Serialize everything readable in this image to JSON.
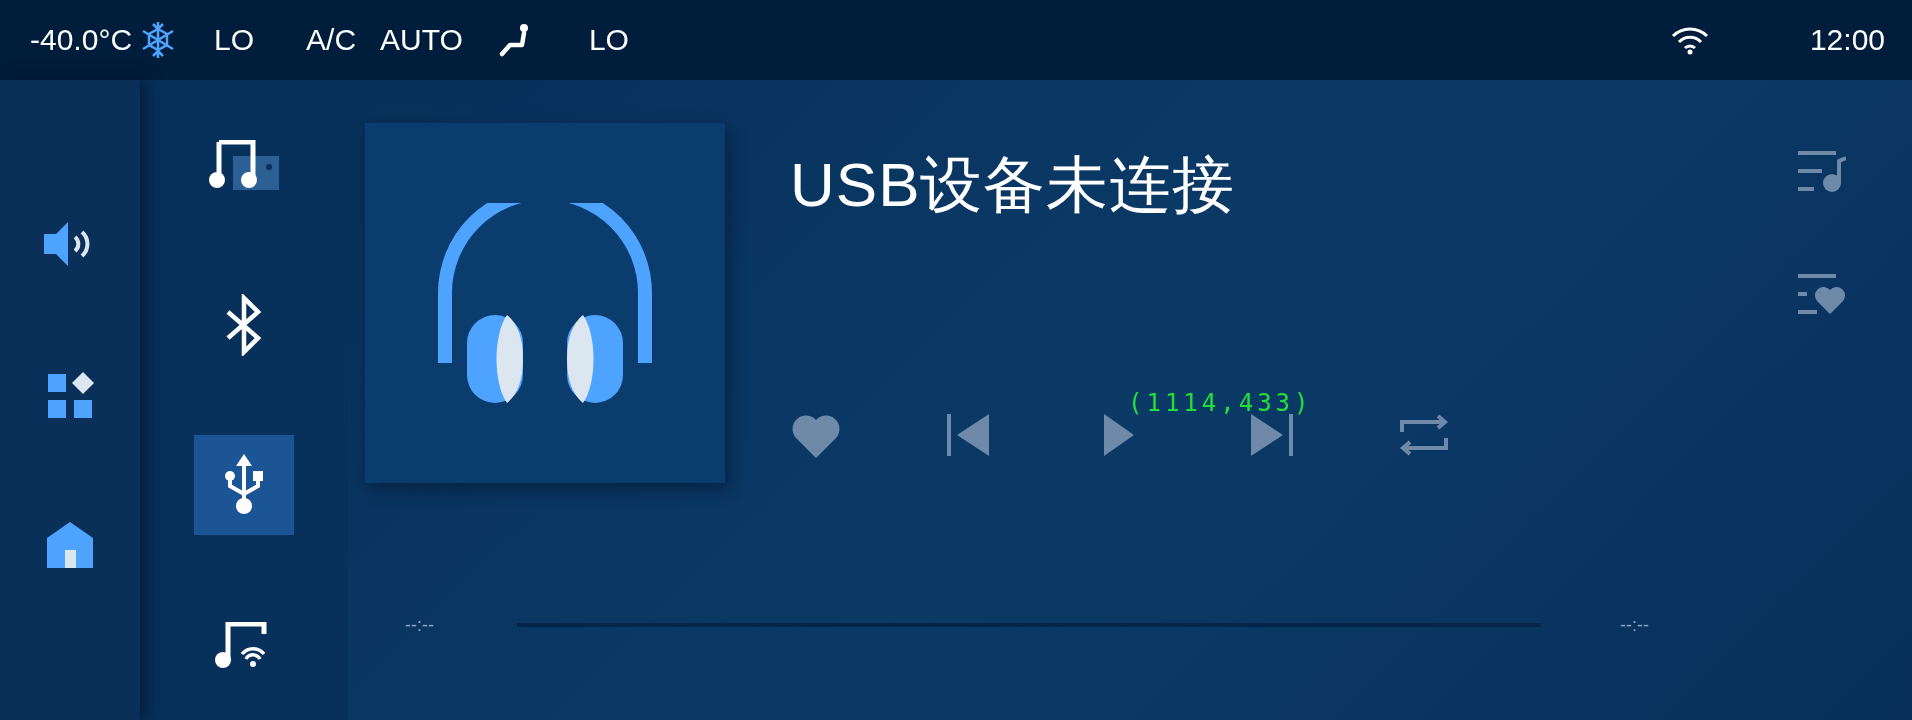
{
  "status_bar": {
    "temperature": "-40.0°C",
    "fan_level": "LO",
    "ac": "A/C",
    "mode": "AUTO",
    "seat_level": "LO",
    "time": "12:00"
  },
  "rail": [
    {
      "kind": "volume"
    },
    {
      "kind": "apps"
    },
    {
      "kind": "home"
    }
  ],
  "sources": [
    {
      "kind": "radio",
      "selected": false
    },
    {
      "kind": "bluetooth",
      "selected": false
    },
    {
      "kind": "usb",
      "selected": true
    },
    {
      "kind": "online-music",
      "selected": false
    }
  ],
  "player": {
    "title": "USB设备未连接",
    "controls": [
      {
        "kind": "favorite"
      },
      {
        "kind": "previous"
      },
      {
        "kind": "play"
      },
      {
        "kind": "next"
      },
      {
        "kind": "repeat"
      }
    ],
    "debug_overlay": "(1114,433)",
    "elapsed": "--:--",
    "duration": "--:--",
    "progress": {
      "level": 0
    },
    "side_buttons": [
      {
        "kind": "playlist"
      },
      {
        "kind": "favorites-list"
      }
    ]
  }
}
